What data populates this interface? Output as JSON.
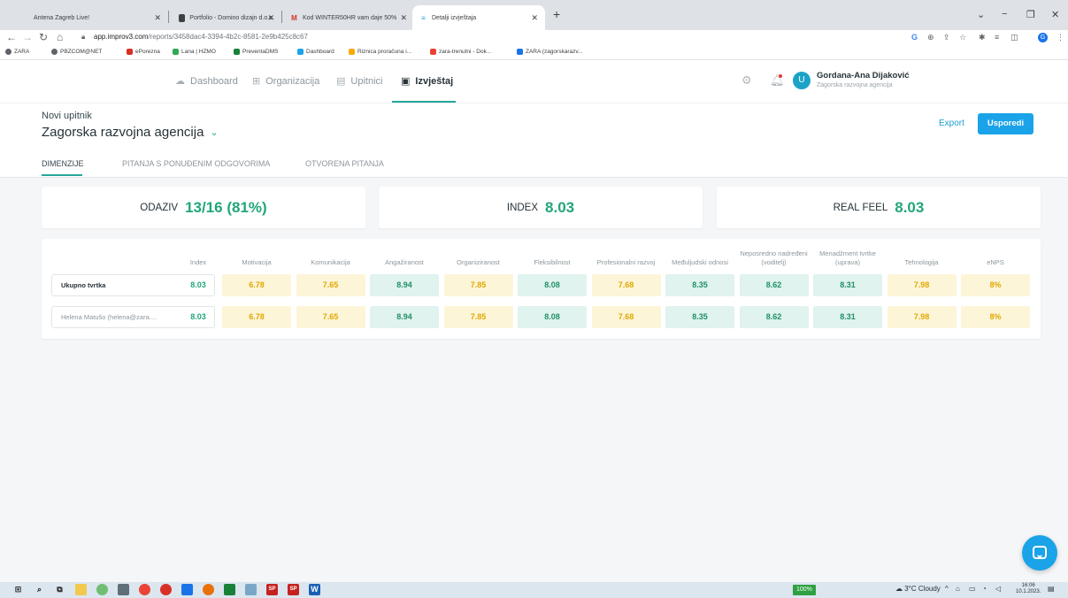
{
  "browser": {
    "tabs": [
      {
        "title": "Antena Zagreb Live!",
        "icon": "radio-icon",
        "active": false
      },
      {
        "title": "Portfolio - Domino dizajn d.o.o.",
        "icon": "page-icon",
        "active": false
      },
      {
        "title": "Kod WINTER50HR vam daje 50%",
        "icon": "gmail-icon",
        "active": false
      },
      {
        "title": "Detalji izvještaja",
        "icon": "improv-icon",
        "active": true
      }
    ],
    "url_host": "app.improv3.com",
    "url_path": "/reports/3458dac4-3394-4b2c-8581-2e9b425c8c67",
    "profile_initial": "G",
    "bookmarks": [
      "ZARA",
      "PBZCOM@NET",
      "ePorezna",
      "Lana | HZMO",
      "PreventaDMS",
      "Dashboard",
      "Riznica proračuna i...",
      "zara-trenutni - Dok...",
      "ZARA (zagorskarazv..."
    ]
  },
  "header": {
    "nav": [
      {
        "label": "Dashboard",
        "icon": "cloud-icon"
      },
      {
        "label": "Organizacija",
        "icon": "org-chart-icon"
      },
      {
        "label": "Upitnici",
        "icon": "form-icon"
      },
      {
        "label": "Izvještaj",
        "icon": "report-icon",
        "active": true
      }
    ],
    "user_initial": "U",
    "user_name": "Gordana-Ana Dijaković",
    "user_org": "Zagorska razvojna agencija"
  },
  "report": {
    "subtitle": "Novi upitnik",
    "title": "Zagorska razvojna agencija",
    "export_label": "Export",
    "compare_label": "Usporedi",
    "tabs": [
      "DIMENZIJE",
      "PITANJA S PONUĐENIM ODGOVORIMA",
      "OTVORENA PITANJA"
    ]
  },
  "kpis": [
    {
      "label": "ODAZIV",
      "value": "13/16 (81%)"
    },
    {
      "label": "INDEX",
      "value": "8.03"
    },
    {
      "label": "REAL FEEL",
      "value": "8.03"
    }
  ],
  "table": {
    "columns": [
      "Index",
      "Motivacija",
      "Komunikacija",
      "Angažiranost",
      "Organiziranost",
      "Fleksibilnost",
      "Profesionalni razvoj",
      "Međuljudski odnosi",
      "Neposredno nadređeni (voditelj)",
      "Menadžment tvrtke (uprava)",
      "Tehnologija",
      "eNPS"
    ],
    "rows": [
      {
        "label": "Ukupno tvrtka",
        "index": "8.03",
        "values": [
          "6.78",
          "7.65",
          "8.94",
          "7.85",
          "8.08",
          "7.68",
          "8.35",
          "8.62",
          "8.31",
          "7.98",
          "8%"
        ]
      },
      {
        "label": "Helena Matušo (helena@zara....",
        "index": "8.03",
        "values": [
          "6.78",
          "7.65",
          "8.94",
          "7.85",
          "8.08",
          "7.68",
          "8.35",
          "8.62",
          "8.31",
          "7.98",
          "8%"
        ]
      }
    ],
    "levels": [
      "mid",
      "mid",
      "high",
      "mid",
      "high",
      "mid",
      "high",
      "high",
      "high",
      "mid",
      "mid"
    ]
  },
  "taskbar": {
    "zoom_badge": "100%",
    "weather": "3°C Cloudy",
    "time": "16:06",
    "date": "10.1.2023."
  },
  "colors": {
    "accent": "#26a69a",
    "primary_button": "#1aa3e8",
    "value_green": "#21a67a",
    "cell_high_bg": "#e0f3ee",
    "cell_mid_bg": "#fdf5d8"
  }
}
